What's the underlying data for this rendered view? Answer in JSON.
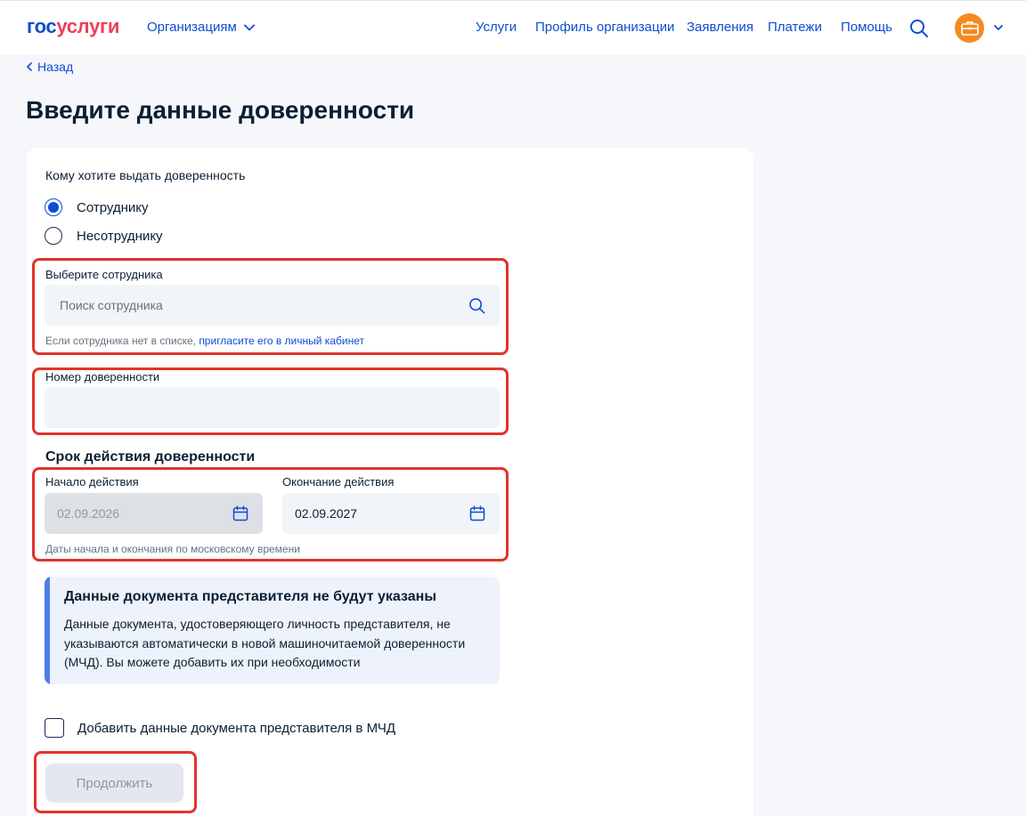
{
  "colors": {
    "accent": "#0d4cd3",
    "logo_red": "#ee3f58",
    "highlight": "#e2342b",
    "avatar": "#f58a1f"
  },
  "header": {
    "logo_part1": "гос",
    "logo_part2": "услуги",
    "org_menu": "Организациям",
    "nav": [
      "Услуги",
      "Профиль организации",
      "Заявления",
      "Платежи",
      "Помощь"
    ],
    "search_icon": "search-icon",
    "avatar_icon": "briefcase-icon"
  },
  "back_label": "Назад",
  "page_title": "Введите данные доверенности",
  "form": {
    "recipient_question": "Кому хотите выдать доверенность",
    "radio_employee": "Сотруднику",
    "radio_non_employee": "Несотруднику",
    "employee_label": "Выберите сотрудника",
    "employee_placeholder": "Поиск сотрудника",
    "employee_hint_prefix": "Если сотрудника нет в списке, ",
    "employee_hint_link": "пригласите его в личный кабинет",
    "number_label": "Номер доверенности",
    "number_value": "",
    "validity_title": "Срок действия доверенности",
    "start_label": "Начало действия",
    "start_value": "02.09.2026",
    "end_label": "Окончание действия",
    "end_value": "02.09.2027",
    "dates_hint": "Даты начала и окончания по московскому времени"
  },
  "info": {
    "title": "Данные документа представителя не будут указаны",
    "text": "Данные документа, удостоверяющего личность представителя, не указываются автоматически в новой машиночитаемой доверенности (МЧД). Вы можете добавить их при необходимости"
  },
  "add_doc_checkbox": "Добавить данные документа представителя в МЧД",
  "continue_label": "Продолжить"
}
